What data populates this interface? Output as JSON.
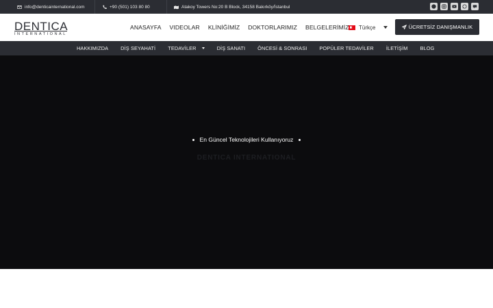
{
  "topbar": {
    "email": "info@denticainternational.com",
    "phone": "+90 (501) 103 80 80",
    "address": "Atakoy Towers No:20 B Block, 34158 Bakırköy/İstanbul",
    "socials": [
      "facebook-icon",
      "instagram-icon",
      "youtube-icon",
      "whatsapp-icon",
      "chat-icon"
    ]
  },
  "header": {
    "logo_main": "DENTICA",
    "logo_sub": "INTERNATIONAL",
    "nav": [
      "ANASAYFA",
      "VIDEOLAR",
      "KLİNİĞİMİZ",
      "DOKTORLARIMIZ",
      "BELGELERİMİZ"
    ],
    "language": "Türkçe",
    "cta_label": "ÜCRETSİZ DANIŞMANLIK"
  },
  "subnav": {
    "items": [
      "HAKKIMIZDA",
      "DİŞ SEYAHATİ",
      "TEDAVİLER",
      "DİŞ SANATI",
      "ÖNCESİ & SONRASI",
      "POPÜLER TEDAVİLER",
      "İLETİŞİM",
      "BLOG"
    ]
  },
  "hero": {
    "tagline": "En Güncel Teknolojileri Kullanıyoruz",
    "ghost_text": "DENTICA INTERNATIONAL"
  },
  "colors": {
    "dark": "#2b2d33",
    "hero_bg": "#0c0c0e",
    "flag_red": "#e30a17"
  }
}
